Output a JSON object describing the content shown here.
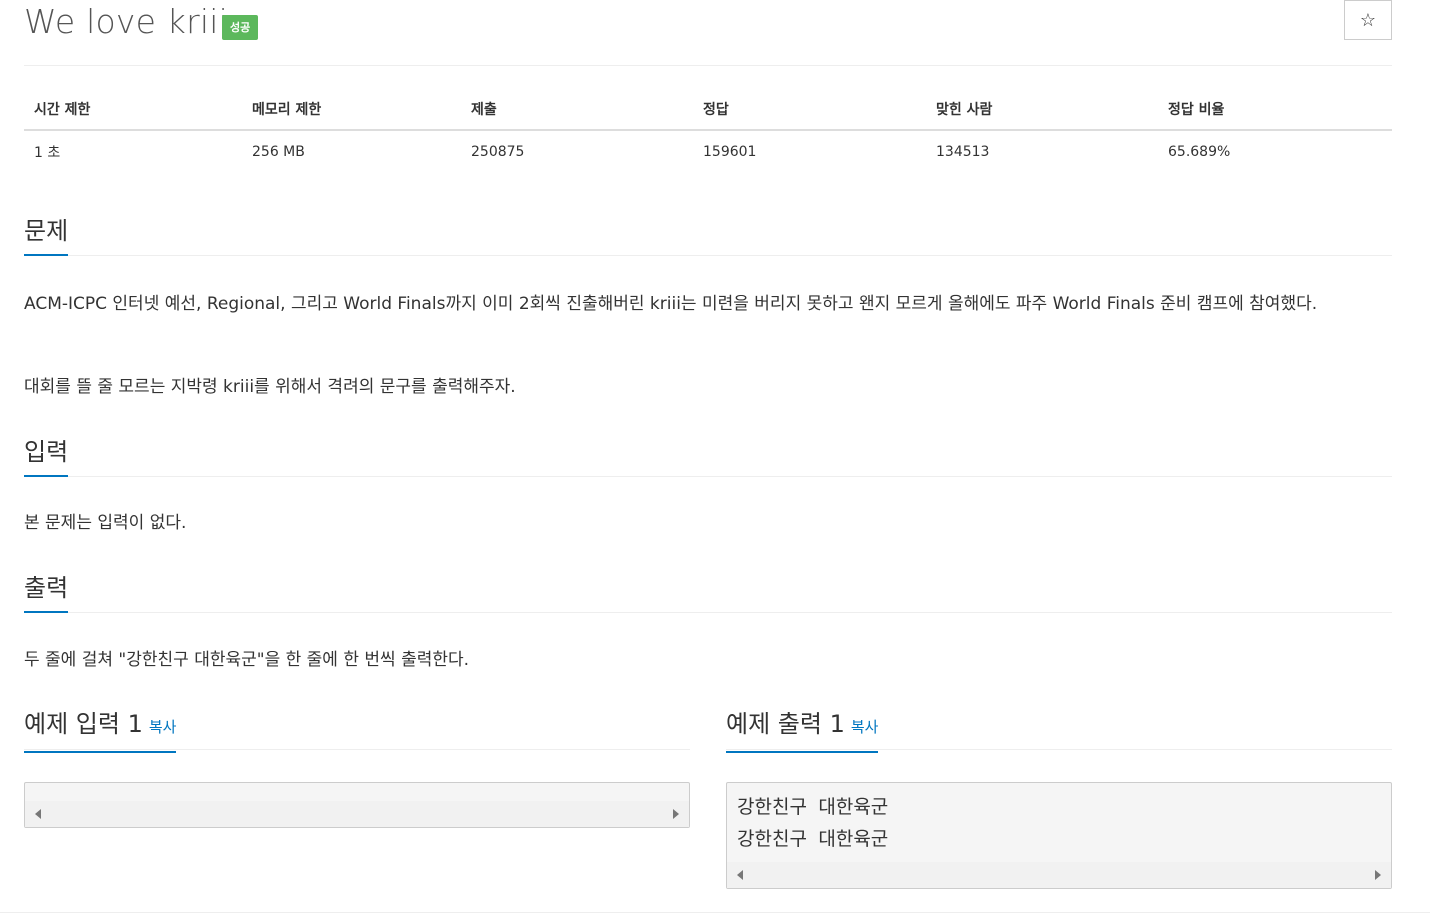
{
  "problem": {
    "title": "We love kriii",
    "badge": "성공",
    "star_icon": "star-icon"
  },
  "info_table": {
    "headers": [
      "시간 제한",
      "메모리 제한",
      "제출",
      "정답",
      "맞힌 사람",
      "정답 비율"
    ],
    "values": [
      "1 초",
      "256 MB",
      "250875",
      "159601",
      "134513",
      "65.689%"
    ]
  },
  "sections": {
    "description": {
      "heading": "문제",
      "paragraphs": [
        "ACM-ICPC 인터넷 예선, Regional, 그리고 World Finals까지 이미 2회씩 진출해버린 kriii는 미련을 버리지 못하고 왠지 모르게 올해에도 파주 World Finals 준비 캠프에 참여했다.",
        "대회를 뜰 줄 모르는 지박령 kriii를 위해서 격려의 문구를 출력해주자."
      ]
    },
    "input": {
      "heading": "입력",
      "text": "본 문제는 입력이 없다."
    },
    "output": {
      "heading": "출력",
      "text": "두 줄에 걸쳐 \"강한친구 대한육군\"을 한 줄에 한 번씩 출력한다."
    }
  },
  "samples": {
    "input": {
      "heading": "예제 입력 1",
      "copy_label": "복사",
      "content": ""
    },
    "output": {
      "heading": "예제 출력 1",
      "copy_label": "복사",
      "content": "강한친구 대한육군\n강한친구 대한육군"
    }
  }
}
